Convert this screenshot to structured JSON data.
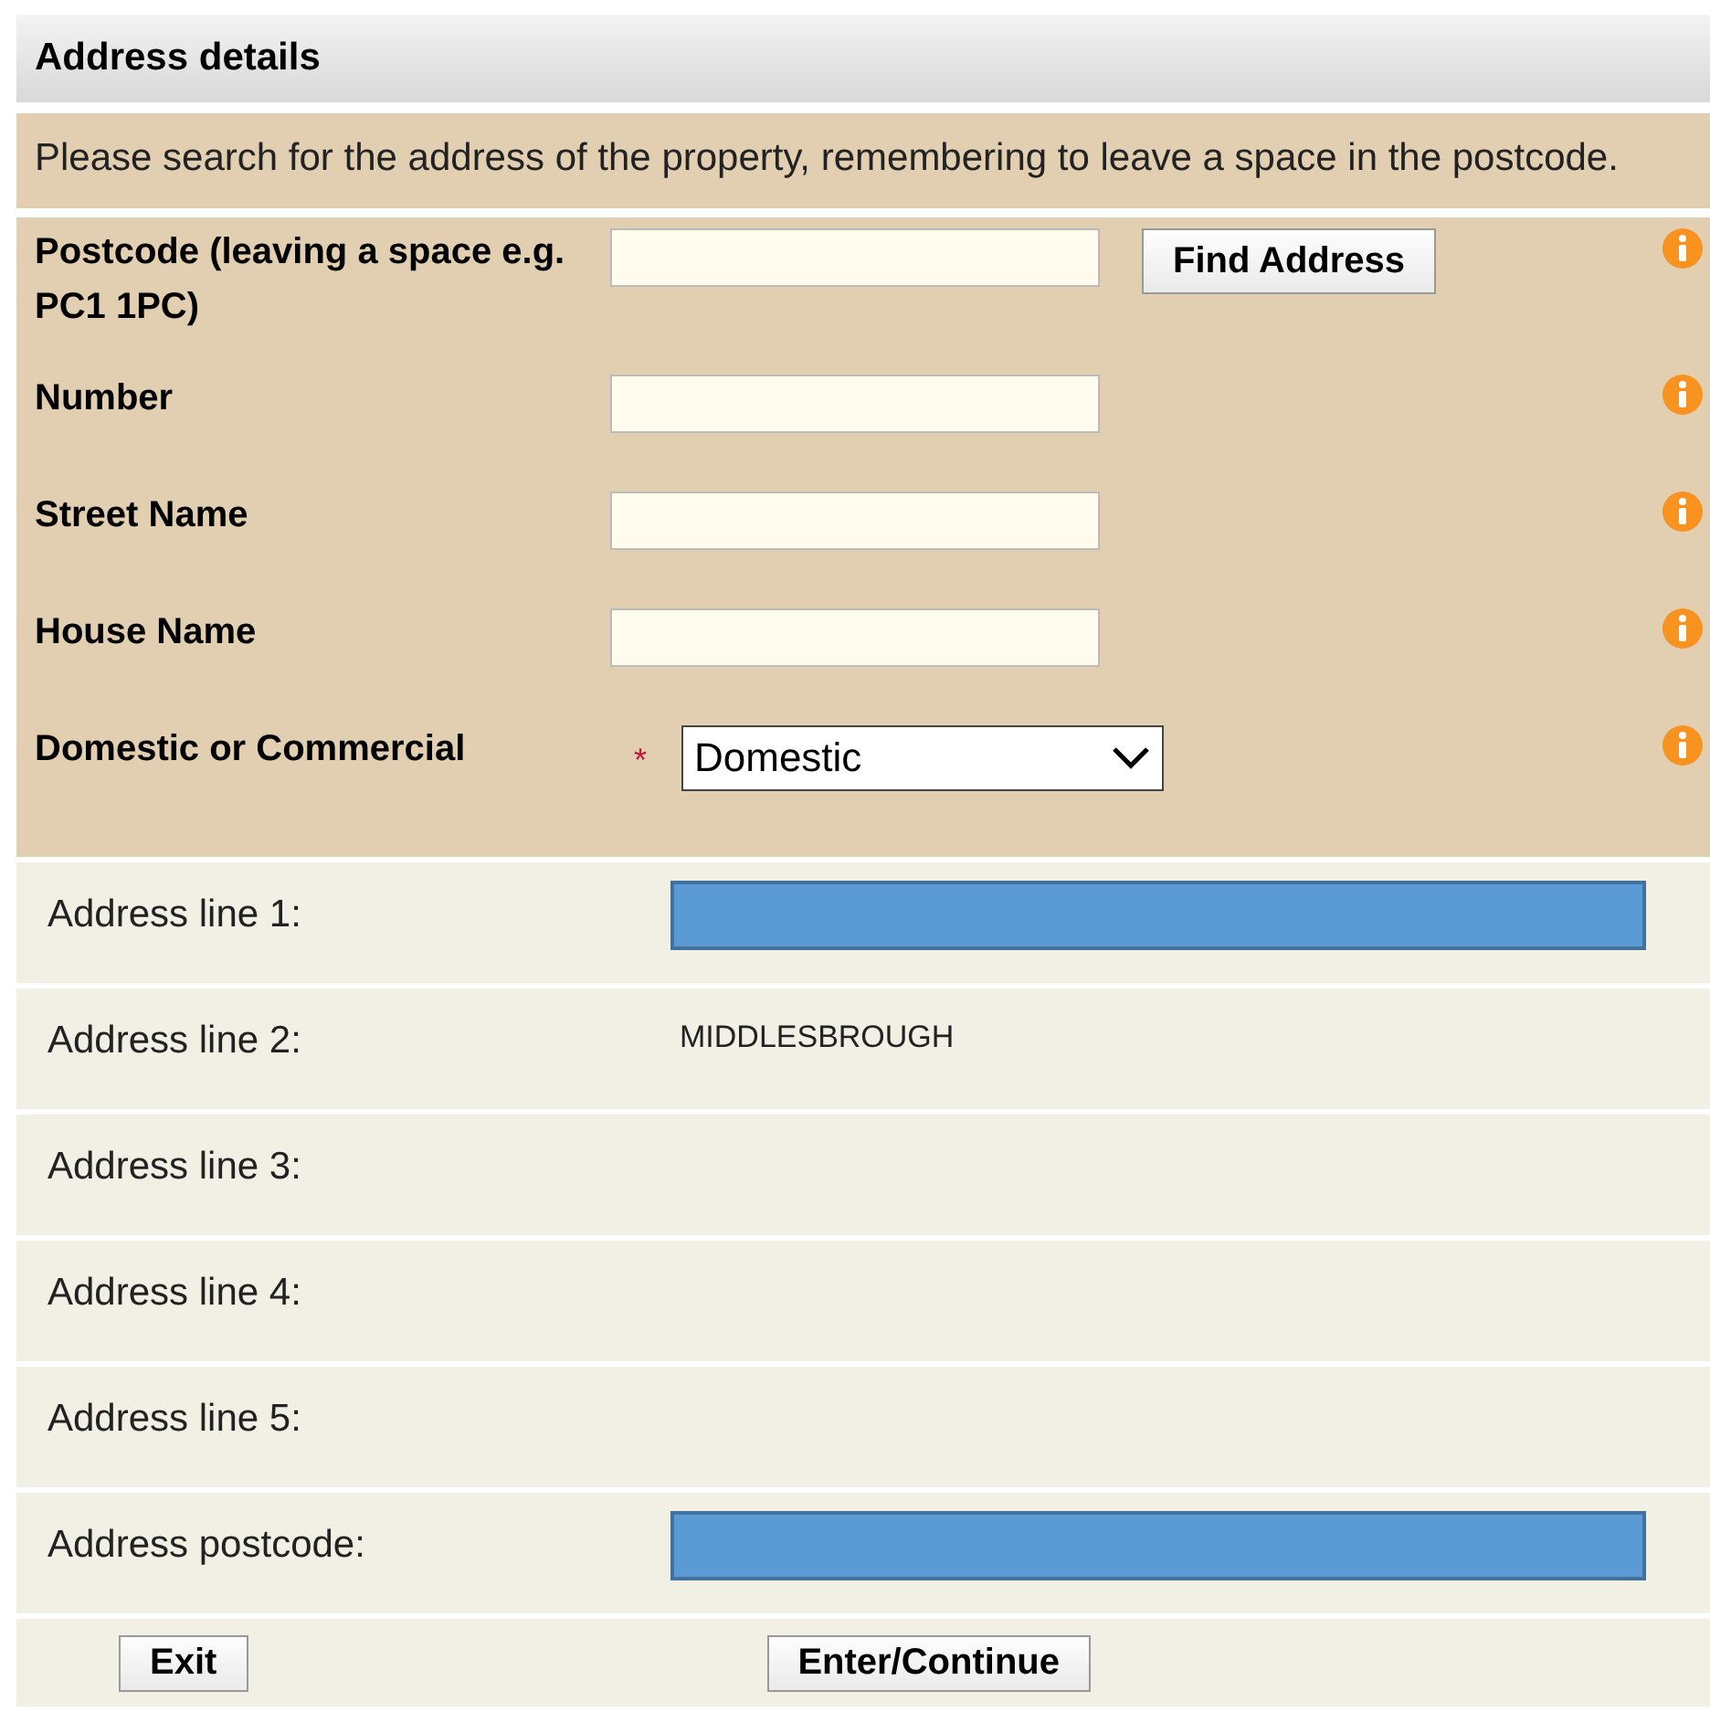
{
  "header": {
    "title": "Address details"
  },
  "instructions": "Please search for the address of the property, remembering to leave a space in the postcode.",
  "search_fields": [
    {
      "kind": "text",
      "label": "Postcode (leaving a space e.g. PC1 1PC)",
      "button": "Find Address",
      "required": false
    },
    {
      "kind": "text",
      "label": "Number",
      "required": false
    },
    {
      "kind": "text",
      "label": "Street Name",
      "required": false
    },
    {
      "kind": "text",
      "label": "House Name",
      "required": false
    },
    {
      "kind": "select",
      "label": "Domestic or Commercial",
      "required": true,
      "required_mark": "*",
      "value": "Domestic"
    }
  ],
  "address_lines": [
    {
      "label": "Address line 1:",
      "kind": "redacted"
    },
    {
      "label": "Address line 2:",
      "kind": "text",
      "value": "MIDDLESBROUGH"
    },
    {
      "label": "Address line 3:",
      "kind": "empty"
    },
    {
      "label": "Address line 4:",
      "kind": "empty"
    },
    {
      "label": "Address line 5:",
      "kind": "empty"
    },
    {
      "label": "Address postcode:",
      "kind": "redacted"
    }
  ],
  "buttons": [
    "Exit",
    "Enter/Continue"
  ]
}
